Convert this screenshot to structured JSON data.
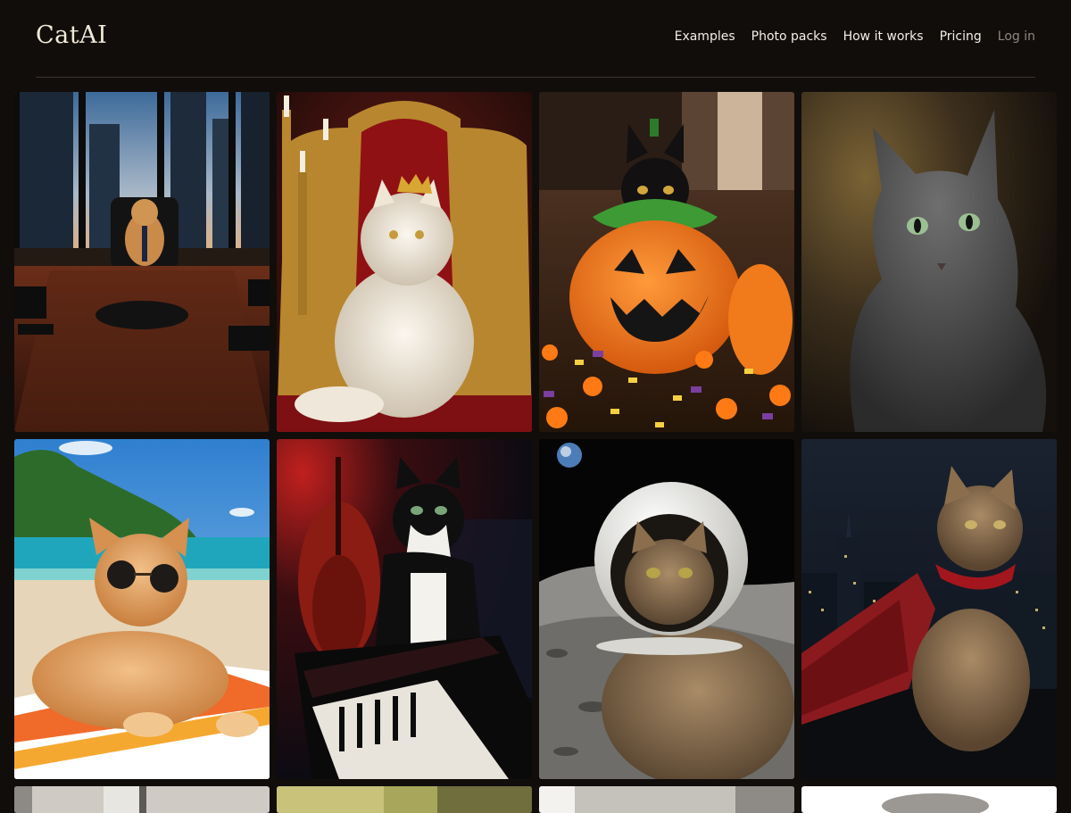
{
  "brand": {
    "name": "CatAI"
  },
  "nav": {
    "items": [
      {
        "label": "Examples"
      },
      {
        "label": "Photo packs"
      },
      {
        "label": "How it works"
      },
      {
        "label": "Pricing"
      },
      {
        "label": "Log in"
      }
    ]
  },
  "gallery": {
    "images": [
      {
        "subject": "cat-ceo-boardroom-image"
      },
      {
        "subject": "white-persian-cat-king-throne-image"
      },
      {
        "subject": "black-cat-pumpkin-costume-image"
      },
      {
        "subject": "grey-cat-portrait-image"
      },
      {
        "subject": "ginger-cat-sunglasses-beach-image"
      },
      {
        "subject": "tuxedo-cat-jazz-bar-piano-image"
      },
      {
        "subject": "tabby-cat-astronaut-moon-image"
      },
      {
        "subject": "tabby-cat-red-cape-city-night-image"
      },
      {
        "subject": "partially-visible-image"
      },
      {
        "subject": "partially-visible-image"
      },
      {
        "subject": "partially-visible-image"
      },
      {
        "subject": "partially-visible-image"
      }
    ]
  },
  "colors": {
    "background": "#110d0b",
    "nav_text": "#f3eee6",
    "nav_muted": "#8f8780",
    "divider": "#3a332e"
  }
}
